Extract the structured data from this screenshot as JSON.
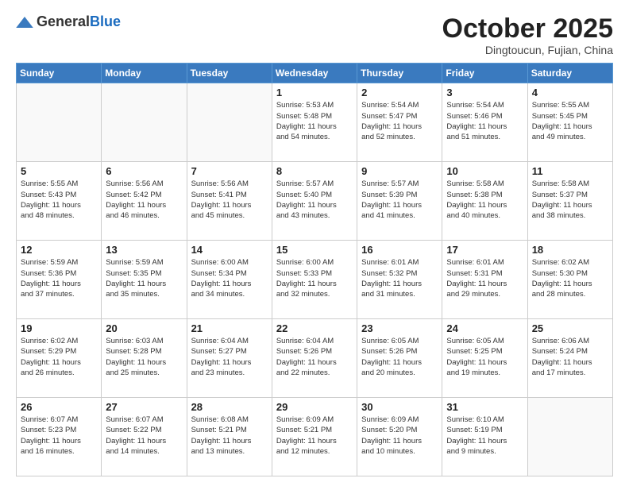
{
  "header": {
    "logo_general": "General",
    "logo_blue": "Blue",
    "month_title": "October 2025",
    "location": "Dingtoucun, Fujian, China"
  },
  "days_of_week": [
    "Sunday",
    "Monday",
    "Tuesday",
    "Wednesday",
    "Thursday",
    "Friday",
    "Saturday"
  ],
  "weeks": [
    [
      {
        "day": "",
        "text": ""
      },
      {
        "day": "",
        "text": ""
      },
      {
        "day": "",
        "text": ""
      },
      {
        "day": "1",
        "text": "Sunrise: 5:53 AM\nSunset: 5:48 PM\nDaylight: 11 hours\nand 54 minutes."
      },
      {
        "day": "2",
        "text": "Sunrise: 5:54 AM\nSunset: 5:47 PM\nDaylight: 11 hours\nand 52 minutes."
      },
      {
        "day": "3",
        "text": "Sunrise: 5:54 AM\nSunset: 5:46 PM\nDaylight: 11 hours\nand 51 minutes."
      },
      {
        "day": "4",
        "text": "Sunrise: 5:55 AM\nSunset: 5:45 PM\nDaylight: 11 hours\nand 49 minutes."
      }
    ],
    [
      {
        "day": "5",
        "text": "Sunrise: 5:55 AM\nSunset: 5:43 PM\nDaylight: 11 hours\nand 48 minutes."
      },
      {
        "day": "6",
        "text": "Sunrise: 5:56 AM\nSunset: 5:42 PM\nDaylight: 11 hours\nand 46 minutes."
      },
      {
        "day": "7",
        "text": "Sunrise: 5:56 AM\nSunset: 5:41 PM\nDaylight: 11 hours\nand 45 minutes."
      },
      {
        "day": "8",
        "text": "Sunrise: 5:57 AM\nSunset: 5:40 PM\nDaylight: 11 hours\nand 43 minutes."
      },
      {
        "day": "9",
        "text": "Sunrise: 5:57 AM\nSunset: 5:39 PM\nDaylight: 11 hours\nand 41 minutes."
      },
      {
        "day": "10",
        "text": "Sunrise: 5:58 AM\nSunset: 5:38 PM\nDaylight: 11 hours\nand 40 minutes."
      },
      {
        "day": "11",
        "text": "Sunrise: 5:58 AM\nSunset: 5:37 PM\nDaylight: 11 hours\nand 38 minutes."
      }
    ],
    [
      {
        "day": "12",
        "text": "Sunrise: 5:59 AM\nSunset: 5:36 PM\nDaylight: 11 hours\nand 37 minutes."
      },
      {
        "day": "13",
        "text": "Sunrise: 5:59 AM\nSunset: 5:35 PM\nDaylight: 11 hours\nand 35 minutes."
      },
      {
        "day": "14",
        "text": "Sunrise: 6:00 AM\nSunset: 5:34 PM\nDaylight: 11 hours\nand 34 minutes."
      },
      {
        "day": "15",
        "text": "Sunrise: 6:00 AM\nSunset: 5:33 PM\nDaylight: 11 hours\nand 32 minutes."
      },
      {
        "day": "16",
        "text": "Sunrise: 6:01 AM\nSunset: 5:32 PM\nDaylight: 11 hours\nand 31 minutes."
      },
      {
        "day": "17",
        "text": "Sunrise: 6:01 AM\nSunset: 5:31 PM\nDaylight: 11 hours\nand 29 minutes."
      },
      {
        "day": "18",
        "text": "Sunrise: 6:02 AM\nSunset: 5:30 PM\nDaylight: 11 hours\nand 28 minutes."
      }
    ],
    [
      {
        "day": "19",
        "text": "Sunrise: 6:02 AM\nSunset: 5:29 PM\nDaylight: 11 hours\nand 26 minutes."
      },
      {
        "day": "20",
        "text": "Sunrise: 6:03 AM\nSunset: 5:28 PM\nDaylight: 11 hours\nand 25 minutes."
      },
      {
        "day": "21",
        "text": "Sunrise: 6:04 AM\nSunset: 5:27 PM\nDaylight: 11 hours\nand 23 minutes."
      },
      {
        "day": "22",
        "text": "Sunrise: 6:04 AM\nSunset: 5:26 PM\nDaylight: 11 hours\nand 22 minutes."
      },
      {
        "day": "23",
        "text": "Sunrise: 6:05 AM\nSunset: 5:26 PM\nDaylight: 11 hours\nand 20 minutes."
      },
      {
        "day": "24",
        "text": "Sunrise: 6:05 AM\nSunset: 5:25 PM\nDaylight: 11 hours\nand 19 minutes."
      },
      {
        "day": "25",
        "text": "Sunrise: 6:06 AM\nSunset: 5:24 PM\nDaylight: 11 hours\nand 17 minutes."
      }
    ],
    [
      {
        "day": "26",
        "text": "Sunrise: 6:07 AM\nSunset: 5:23 PM\nDaylight: 11 hours\nand 16 minutes."
      },
      {
        "day": "27",
        "text": "Sunrise: 6:07 AM\nSunset: 5:22 PM\nDaylight: 11 hours\nand 14 minutes."
      },
      {
        "day": "28",
        "text": "Sunrise: 6:08 AM\nSunset: 5:21 PM\nDaylight: 11 hours\nand 13 minutes."
      },
      {
        "day": "29",
        "text": "Sunrise: 6:09 AM\nSunset: 5:21 PM\nDaylight: 11 hours\nand 12 minutes."
      },
      {
        "day": "30",
        "text": "Sunrise: 6:09 AM\nSunset: 5:20 PM\nDaylight: 11 hours\nand 10 minutes."
      },
      {
        "day": "31",
        "text": "Sunrise: 6:10 AM\nSunset: 5:19 PM\nDaylight: 11 hours\nand 9 minutes."
      },
      {
        "day": "",
        "text": ""
      }
    ]
  ]
}
